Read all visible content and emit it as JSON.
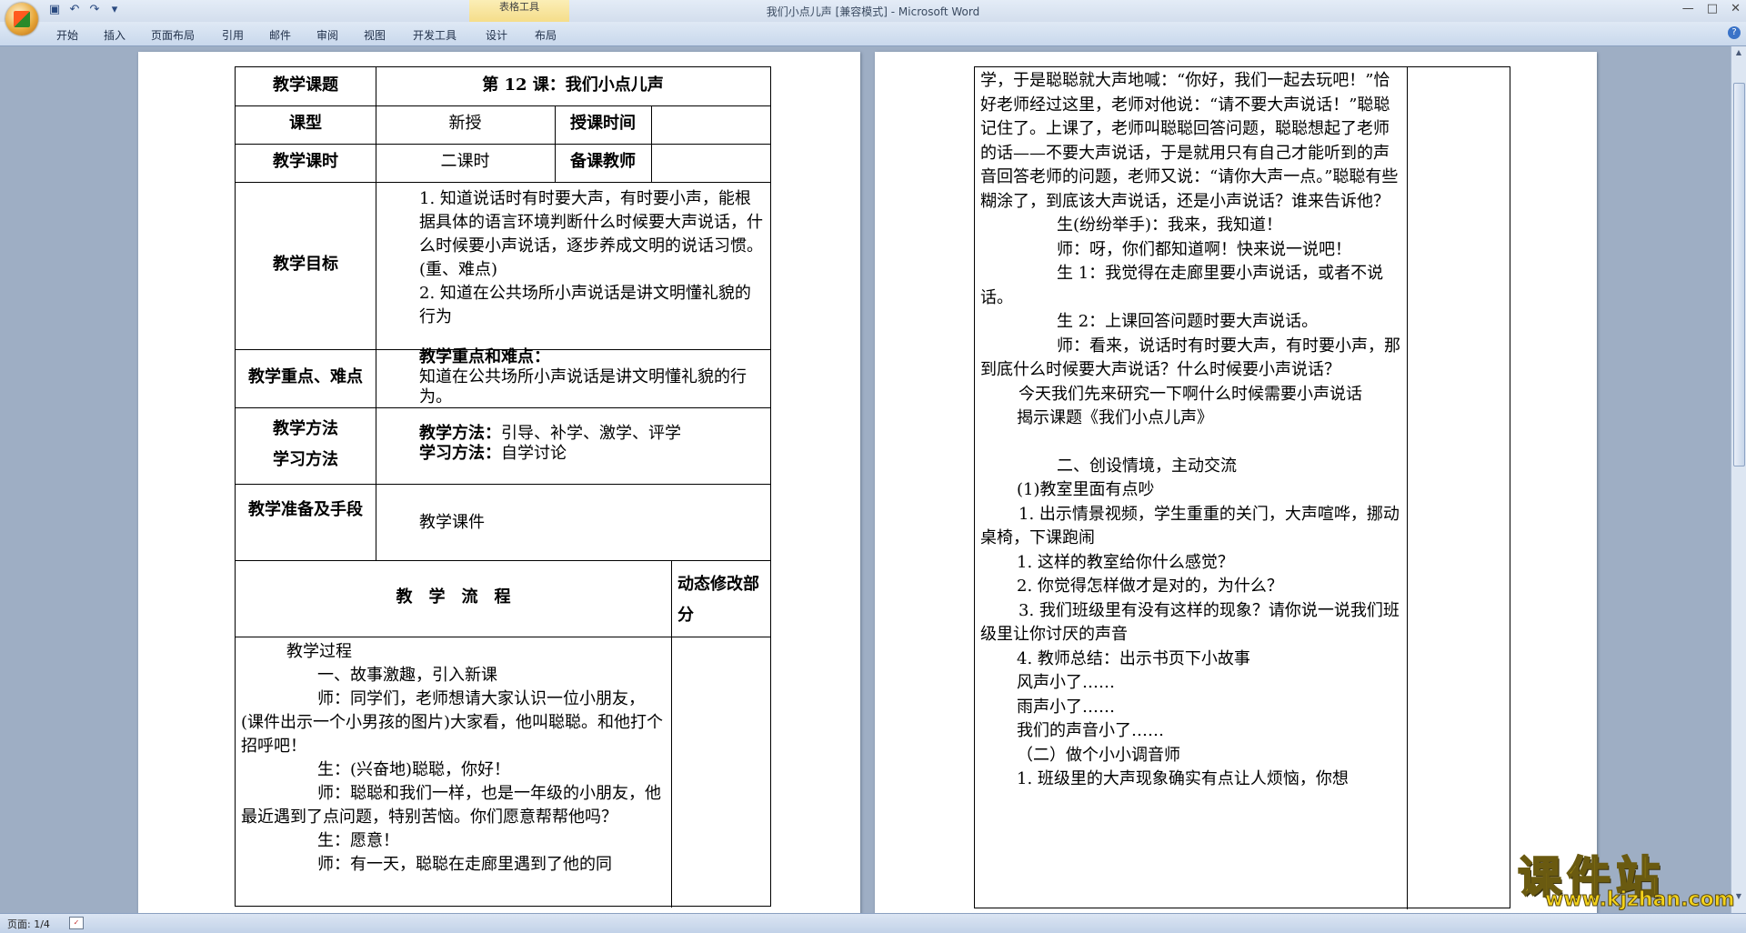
{
  "app": {
    "window_title": "我们小点儿声 [兼容模式] - Microsoft Word",
    "context_tab_group": "表格工具",
    "tabs": [
      "开始",
      "插入",
      "页面布局",
      "引用",
      "邮件",
      "审阅",
      "视图",
      "开发工具",
      "设计",
      "布局"
    ],
    "status_page": "页面: 1/4"
  },
  "left_table": {
    "topic_label": "教学课题",
    "topic_value": "第 12 课：我们小点儿声",
    "type_label": "课型",
    "type_value": "新授",
    "time_label": "授课时间",
    "hours_label": "教学课时",
    "hours_value": "二课时",
    "teacher_label": "备课教师",
    "goal_label": "教学目标",
    "goal_1": "1. 知道说话时有时要大声，有时要小声，能根据具体的语言环境判断什么时候要大声说话，什么时候要小声说话，逐步养成文明的说话习惯。(重、难点)",
    "goal_2": "2. 知道在公共场所小声说话是讲文明懂礼貌的行为",
    "key_label": "教学重点、难点",
    "key_title": "教学重点和难点：",
    "key_text": "知道在公共场所小声说话是讲文明懂礼貌的行为。",
    "method_label_1": "教学方法",
    "method_label_2": "学习方法",
    "method_title_1": "教学方法：",
    "method_text_1": "引导、补学、激学、评学",
    "method_title_2": "学习方法：",
    "method_text_2": "自学讨论",
    "prep_label": "教学准备及手段",
    "prep_value": "教学课件",
    "flow_label": "教　学　流　程",
    "dynamic_label": "动态修改部分",
    "process": [
      "教学过程",
      "一、故事激趣，引入新课",
      "师：同学们，老师想请大家认识一位小朋友，(课件出示一个小男孩的图片)大家看，他叫聪聪。和他打个招呼吧！",
      "生：(兴奋地)聪聪，你好！",
      "师：聪聪和我们一样，也是一年级的小朋友，他最近遇到了点问题，特别苦恼。你们愿意帮帮他吗？",
      "生：愿意！",
      "师：有一天，聪聪在走廊里遇到了他的同"
    ]
  },
  "right_table": {
    "paragraphs": [
      "学，于是聪聪就大声地喊：“你好，我们一起去玩吧！”恰好老师经过这里，老师对他说：“请不要大声说话！”聪聪记住了。上课了，老师叫聪聪回答问题，聪聪想起了老师的话——不要大声说话，于是就用只有自己才能听到的声音回答老师的问题，老师又说：“请你大声一点。”聪聪有些糊涂了，到底该大声说话，还是小声说话？谁来告诉他？",
      "生(纷纷举手)：我来，我知道！",
      "师：呀，你们都知道啊！快来说一说吧！",
      "生 1：我觉得在走廊里要小声说话，或者不说话。",
      "生 2：上课回答问题时要大声说话。",
      "师：看来，说话时有时要大声，有时要小声，那到底什么时候要大声说话？什么时候要小声说话？",
      "今天我们先来研究一下啊什么时候需要小声说话",
      "揭示课题《我们小点儿声》",
      "",
      "二、创设情境，主动交流",
      "(1)教室里面有点吵",
      "1. 出示情景视频，学生重重的关门，大声喧哗，挪动桌椅，下课跑闹",
      "1. 这样的教室给你什么感觉？",
      "2. 你觉得怎样做才是对的，为什么？",
      "3. 我们班级里有没有这样的现象？请你说一说我们班级里让你讨厌的声音",
      "4. 教师总结：出示书页下小故事",
      "风声小了……",
      "雨声小了……",
      "我们的声音小了……",
      "（二）做个小小调音师",
      "1. 班级里的大声现象确实有点让人烦恼，你想"
    ]
  },
  "watermark": {
    "brand": "课件站",
    "url": "www.kjzhan.com"
  },
  "para_mark": "↵"
}
